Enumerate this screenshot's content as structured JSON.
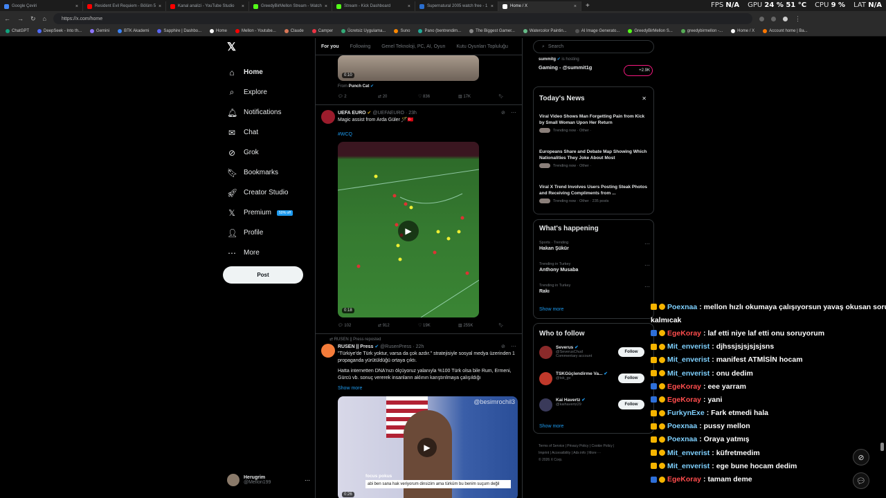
{
  "browser": {
    "tabs": [
      {
        "title": "Google Çeviri",
        "color": "#4285f4",
        "active": false
      },
      {
        "title": "Resident Evil Requiem - Bölüm 5",
        "color": "#ff0000",
        "active": false
      },
      {
        "title": "Kanal analizi - YouTube Studio",
        "color": "#ff0000",
        "active": false
      },
      {
        "title": "GreedyBirMellon Stream - Watch",
        "color": "#53fc18",
        "active": false
      },
      {
        "title": "Stream - Kick Dashboard",
        "color": "#53fc18",
        "active": false
      },
      {
        "title": "Supernatural 2005 watch free - 1",
        "color": "#2a6ecf",
        "active": false
      },
      {
        "title": "Home / X",
        "color": "#ffffff",
        "active": true
      }
    ],
    "new_tab": "+",
    "url": "https://x.com/home",
    "stats": {
      "fps_label": "FPS",
      "fps": "N/A",
      "gpu_label": "GPU",
      "gpu": "24 % 51 °C",
      "cpu_label": "CPU",
      "cpu": "9 %",
      "lat_label": "LAT",
      "lat": "N/A"
    },
    "bookmarks": [
      "ChatGPT",
      "DeepSeek - Into th...",
      "Gemini",
      "BTK Akademi",
      "Sapphire | Dashbo...",
      "Home",
      "Mellon - Youtube...",
      "Claude",
      "Camper",
      "Ücretsiz Uygulama...",
      "Suno",
      "Pano (bentrendim...",
      "The Biggest Gamer...",
      "Watercolor Paintin...",
      "AI Image Generato...",
      "GreedyBirMellon S...",
      "greedybirmellon -...",
      "Home / X",
      "Account home | Ba..."
    ]
  },
  "nav": {
    "logo": "𝕏",
    "items": [
      {
        "label": "Home",
        "icon": "⌂",
        "name": "home"
      },
      {
        "label": "Explore",
        "icon": "⌕",
        "name": "explore"
      },
      {
        "label": "Notifications",
        "icon": "🔔︎",
        "name": "notifications"
      },
      {
        "label": "Chat",
        "icon": "✉",
        "name": "chat"
      },
      {
        "label": "Grok",
        "icon": "⊘",
        "name": "grok"
      },
      {
        "label": "Bookmarks",
        "icon": "🔖︎",
        "name": "bookmarks"
      },
      {
        "label": "Creator Studio",
        "icon": "🚀︎",
        "name": "creator-studio"
      },
      {
        "label": "Premium",
        "icon": "𝕏",
        "name": "premium"
      },
      {
        "label": "Profile",
        "icon": "👤︎",
        "name": "profile"
      },
      {
        "label": "More",
        "icon": "⋯",
        "name": "more"
      }
    ],
    "premium_badge": "50% off",
    "post": "Post",
    "account": {
      "name": "Herugrim",
      "handle": "@Mellon199",
      "more": "⋯"
    }
  },
  "feed": {
    "tabs": [
      "For you",
      "Following",
      "Genel Teknoloji, PC, AI, Oyun",
      "Kutu Oyunları Topluluğu"
    ],
    "top_post": {
      "duration": "0:10",
      "from_label": "From",
      "from": "Punch Cat",
      "replies": "2",
      "reposts": "20",
      "likes": "836",
      "views": "17K"
    },
    "post1": {
      "name": "UEFA EURO",
      "handle": "@UEFAEURO",
      "time": "23h",
      "text": "Magic assist from Arda Güler 🪄🇹🇷",
      "hashtag": "#WCQ",
      "duration": "0:18",
      "replies": "102",
      "reposts": "912",
      "likes": "19K",
      "views": "255K"
    },
    "post2": {
      "repost_label": "RUSEN || Press reposted",
      "name": "RUSEN || Press",
      "handle": "@RusenPress",
      "time": "22h",
      "text1": "\"Türkiye'de Türk yoktur, varsa da çok azdır.\" stratejisiyle sosyal medya üzerinden 1 propaganda yürütüldüğü ortaya çıktı.",
      "text2": "Hatta internetten DNA'nızı ölçüyoruz yalanıyla %100 Türk olsa bile Rum, Ermeni, Gürcü vb. sonuç vererek insanların aklının karıştırılmaya çalışıldığı",
      "show_more": "Show more",
      "watermark": "@besimrochil3",
      "caption_title": "focus pokus",
      "caption_text": "abi ben sana hak veriyorum dinsizim ama türküm bu benim suçum değil",
      "duration": "0:26"
    }
  },
  "right": {
    "search_placeholder": "Search",
    "live": {
      "user": "summitg",
      "status": "is hosting",
      "title": "Gaming - @summit1g",
      "count": "+2.9K"
    },
    "news": {
      "title": "Today's News",
      "close": "✕",
      "items": [
        {
          "title": "Viral Video Shows Man Forgetting Pain from Kick by Small Woman Upon Her Return",
          "meta": "Trending now · Other ·"
        },
        {
          "title": "Europeans Share and Debate Map Showing Which Nationalities They Joke About Most",
          "meta": "Trending now · Other ·"
        },
        {
          "title": "Viral X Trend Involves Users Posting Steak Photos and Receiving Compliments from ...",
          "meta": "Trending now · Other · 235 posts"
        }
      ]
    },
    "happening": {
      "title": "What's happening",
      "items": [
        {
          "context": "Sports · Trending",
          "name": "Hakan Şükür"
        },
        {
          "context": "Trending in Turkey",
          "name": "Anthony Musaba"
        },
        {
          "context": "Trending in Turkey",
          "name": "Rakı"
        }
      ],
      "show_more": "Show more"
    },
    "follow": {
      "title": "Who to follow",
      "items": [
        {
          "name": "Severus",
          "handle": "@SeverusChud",
          "extra": "Commentary account"
        },
        {
          "name": "TSKGüçlendirme Va...",
          "handle": "@tsk_gv",
          "extra": ""
        },
        {
          "name": "Kai Havertz",
          "handle": "@kaihavertz29",
          "extra": ""
        }
      ],
      "button": "Follow",
      "show_more": "Show more"
    },
    "footer": {
      "line1": "Terms of Service  |  Privacy Policy  |  Cookie Policy  |",
      "line2": "Imprint  |  Accessibility  |  Ads info  |  More ···",
      "line3": "© 2026 X Corp."
    }
  },
  "chat": {
    "messages": [
      {
        "user": "Poexnaa",
        "color": "#7fd1ff",
        "text": ": mellon hızlı okumaya çalışıyorsun yavaş okusan soru",
        "cont": "kalmıcak"
      },
      {
        "user": "EgeKoray",
        "color": "#ff4d4d",
        "text": ": laf etti niye laf etti onu soruyorum"
      },
      {
        "user": "Mit_enverist",
        "color": "#7fd1ff",
        "text": ": djhssjsjsjsjsjsns"
      },
      {
        "user": "Mit_enverist",
        "color": "#7fd1ff",
        "text": ": manifest ATMİSİN hocam"
      },
      {
        "user": "Mit_enverist",
        "color": "#7fd1ff",
        "text": ": onu dedim"
      },
      {
        "user": "EgeKoray",
        "color": "#ff4d4d",
        "text": ": eee yarram"
      },
      {
        "user": "EgeKoray",
        "color": "#ff4d4d",
        "text": ": yani"
      },
      {
        "user": "FurkynExe",
        "color": "#7fd1ff",
        "text": ": Fark etmedi hala"
      },
      {
        "user": "Poexnaa",
        "color": "#7fd1ff",
        "text": ": pussy mellon"
      },
      {
        "user": "Poexnaa",
        "color": "#7fd1ff",
        "text": ": Oraya yatmış"
      },
      {
        "user": "Mit_enverist",
        "color": "#7fd1ff",
        "text": ": küfretmedim"
      },
      {
        "user": "Mit_enverist",
        "color": "#7fd1ff",
        "text": ": ege bune hocam dedim"
      },
      {
        "user": "EgeKoray",
        "color": "#ff4d4d",
        "text": ": tamam deme"
      }
    ]
  }
}
